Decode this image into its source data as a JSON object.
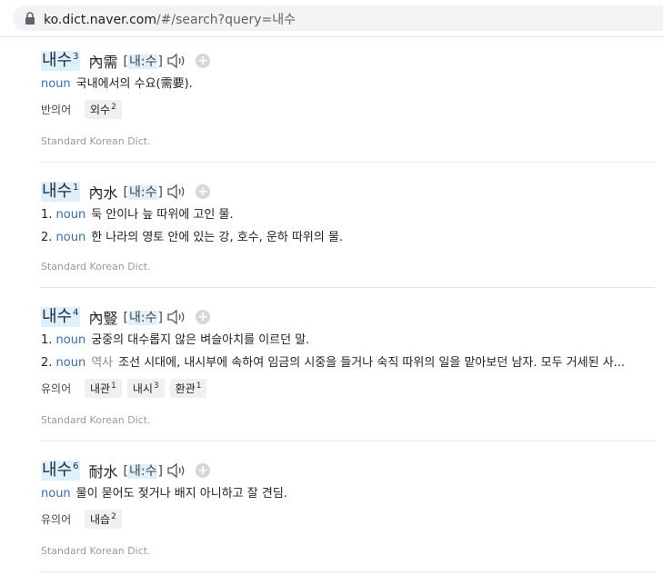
{
  "browser": {
    "url_host": "ko.dict.naver.com",
    "url_path": "/#/search?query=내수"
  },
  "entries": [
    {
      "headword": "내수",
      "sup": "3",
      "hanja": "內需",
      "pron": "내:수",
      "defs": [
        {
          "num": "",
          "pos": "noun",
          "field": "",
          "text": "국내에서의 수요(需要)."
        }
      ],
      "relation": {
        "label": "반의어",
        "items": [
          {
            "word": "외수",
            "sup": "2"
          }
        ]
      },
      "source": "Standard Korean Dict."
    },
    {
      "headword": "내수",
      "sup": "1",
      "hanja": "內水",
      "pron": "내:수",
      "defs": [
        {
          "num": "1.",
          "pos": "noun",
          "field": "",
          "text": "둑 안이나 늪 따위에 고인 물."
        },
        {
          "num": "2.",
          "pos": "noun",
          "field": "",
          "text": "한 나라의 영토 안에 있는 강, 호수, 운하 따위의 물."
        }
      ],
      "relation": null,
      "source": "Standard Korean Dict."
    },
    {
      "headword": "내수",
      "sup": "4",
      "hanja": "內豎",
      "pron": "내:수",
      "defs": [
        {
          "num": "1.",
          "pos": "noun",
          "field": "",
          "text": "궁중의 대수롭지 않은 벼슬아치를 이르던 말."
        },
        {
          "num": "2.",
          "pos": "noun",
          "field": "역사",
          "text": "조선 시대에, 내시부에 속하여 임금의 시중을 들거나 숙직 따위의 일을 맡아보던 남자. 모두 거세된 사..."
        }
      ],
      "relation": {
        "label": "유의어",
        "items": [
          {
            "word": "내관",
            "sup": "1"
          },
          {
            "word": "내시",
            "sup": "3"
          },
          {
            "word": "환관",
            "sup": "1"
          }
        ]
      },
      "source": "Standard Korean Dict."
    },
    {
      "headword": "내수",
      "sup": "6",
      "hanja": "耐水",
      "pron": "내:수",
      "defs": [
        {
          "num": "",
          "pos": "noun",
          "field": "",
          "text": "물이 묻어도 젖거나 배지 아니하고 잘 견딤."
        }
      ],
      "relation": {
        "label": "유의어",
        "items": [
          {
            "word": "내습",
            "sup": "2"
          }
        ]
      },
      "source": "Standard Korean Dict."
    }
  ],
  "colors": {
    "highlight": "#dff0fb",
    "pos": "#3b6ea8",
    "source": "#9a9a9a"
  },
  "icons": {
    "lock": "lock-icon",
    "speaker": "speaker-icon",
    "add": "plus-icon"
  }
}
